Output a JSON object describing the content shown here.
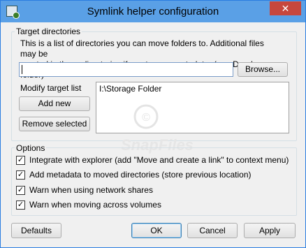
{
  "window": {
    "title": "Symlink helper configuration",
    "close_glyph": "✕"
  },
  "target_group": {
    "label": "Target directories",
    "description_line1": "This is a list of directories you can move folders to. Additional files may be",
    "description_line2": "created in those directories if you turn on metadata. (e.g. Dropbox folder)",
    "path_value": "",
    "browse_label": "Browse...",
    "modify_label": "Modify target list",
    "add_label": "Add new",
    "remove_label": "Remove selected",
    "list_items": [
      "I:\\Storage Folder"
    ]
  },
  "options_group": {
    "label": "Options",
    "items": [
      {
        "label": "Integrate with explorer (add \"Move and create a link\" to context menu)",
        "checked": true
      },
      {
        "label": "Add metadata to moved directories (store previous location)",
        "checked": true
      },
      {
        "label": "Warn when using network shares",
        "checked": true
      },
      {
        "label": "Warn when moving across volumes",
        "checked": true
      }
    ],
    "check_glyph": "✓"
  },
  "footer": {
    "defaults_label": "Defaults",
    "ok_label": "OK",
    "cancel_label": "Cancel",
    "apply_label": "Apply"
  },
  "watermark": {
    "text": "SnapFiles"
  },
  "colors": {
    "titlebar": "#5aa0e6",
    "close": "#c7473d",
    "accent": "#3c7fb1"
  }
}
